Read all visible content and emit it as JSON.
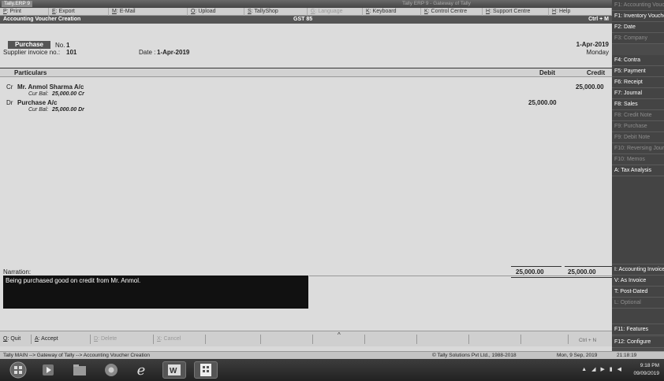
{
  "window": {
    "title": "Tally.ERP 9",
    "center_text": "Tally ERP 9 - Gateway of Tally"
  },
  "menu": [
    {
      "key": "P",
      "label": ": Print",
      "dim": false
    },
    {
      "key": "E",
      "label": ": Export",
      "dim": false
    },
    {
      "key": "M",
      "label": ": E-Mail",
      "dim": false
    },
    {
      "key": "O",
      "label": ": Upload",
      "dim": false
    },
    {
      "key": "S",
      "label": ": TallyShop",
      "dim": false
    },
    {
      "key": "G",
      "label": ": Language",
      "dim": true
    },
    {
      "key": "K",
      "label": ": Keyboard",
      "dim": false
    },
    {
      "key": "K",
      "label": ": Control Centre",
      "dim": false
    },
    {
      "key": "H",
      "label": ": Support Centre",
      "dim": false
    },
    {
      "key": "H",
      "label": ": Help",
      "dim": false
    }
  ],
  "voucher": {
    "header_left": "Accounting Voucher Creation",
    "header_center": "GST 85",
    "header_right": "Ctrl + M",
    "type": "Purchase",
    "number_label": "No.",
    "number": "1",
    "supplier_label": "Supplier invoice no.:",
    "supplier_no": "101",
    "date_label": "Date :",
    "date": "1-Apr-2019",
    "right_date": "1-Apr-2019",
    "right_day": "Monday",
    "col_particulars": "Particulars",
    "col_debit": "Debit",
    "col_credit": "Credit",
    "entries": [
      {
        "drcr": "Cr",
        "account": "Mr. Anmol Sharma A/c",
        "bal_label": "Cur Bal:",
        "bal": "25,000.00 Cr",
        "debit": "",
        "credit": "25,000.00"
      },
      {
        "drcr": "Dr",
        "account": "Purchase A/c",
        "bal_label": "Cur Bal:",
        "bal": "25,000.00 Dr",
        "debit": "25,000.00",
        "credit": ""
      }
    ],
    "narration_label": "Narration:",
    "narration": "Being purchased good on credit from Mr. Anmol.",
    "total_debit": "25,000.00",
    "total_credit": "25,000.00"
  },
  "bottom_buttons": [
    {
      "key": "Q",
      "label": ": Quit",
      "dim": false
    },
    {
      "key": "A",
      "label": ": Accept",
      "dim": false
    },
    {
      "key": "D",
      "label": ": Delete",
      "dim": true
    },
    {
      "key": "X",
      "label": ": Cancel",
      "dim": true
    }
  ],
  "bottom_shortcut": "Ctrl + N",
  "side_buttons": [
    {
      "label": "F1: Accounting Vouchers",
      "dim": true
    },
    {
      "label": "F1: Inventory Vouchers",
      "dim": false
    },
    {
      "label": "F2: Date",
      "dim": false
    },
    {
      "label": "F3: Company",
      "dim": true
    },
    {
      "label": "F4: Contra",
      "dim": false
    },
    {
      "label": "F5: Payment",
      "dim": false
    },
    {
      "label": "F6: Receipt",
      "dim": false
    },
    {
      "label": "F7: Journal",
      "dim": false
    },
    {
      "label": "F8: Sales",
      "dim": false
    },
    {
      "label": "F8: Credit Note",
      "dim": true
    },
    {
      "label": "F9: Purchase",
      "dim": true
    },
    {
      "label": "F9: Debit Note",
      "dim": true
    },
    {
      "label": "F10: Reversing Journal",
      "dim": true
    },
    {
      "label": "F10: Memos",
      "dim": true
    },
    {
      "label": "A: Tax Analysis",
      "dim": false
    },
    {
      "label": "I: Accounting Invoice",
      "dim": false
    },
    {
      "label": "V: As Invoice",
      "dim": false
    },
    {
      "label": "T: Post-Dated",
      "dim": false
    },
    {
      "label": "L: Optional",
      "dim": true
    },
    {
      "label": "F11: Features",
      "dim": false
    },
    {
      "label": "F12: Configure",
      "dim": false
    }
  ],
  "status": {
    "path": "Tally MAIN --> Gateway of Tally --> Accounting Voucher Creation",
    "copyright": "© Tally Solutions Pvt Ltd., 1988-2018",
    "date": "Mon, 9 Sep, 2019",
    "time": "21:18:19"
  },
  "taskbar": {
    "clock_time": "9:18 PM",
    "clock_date": "09/09/2019"
  }
}
